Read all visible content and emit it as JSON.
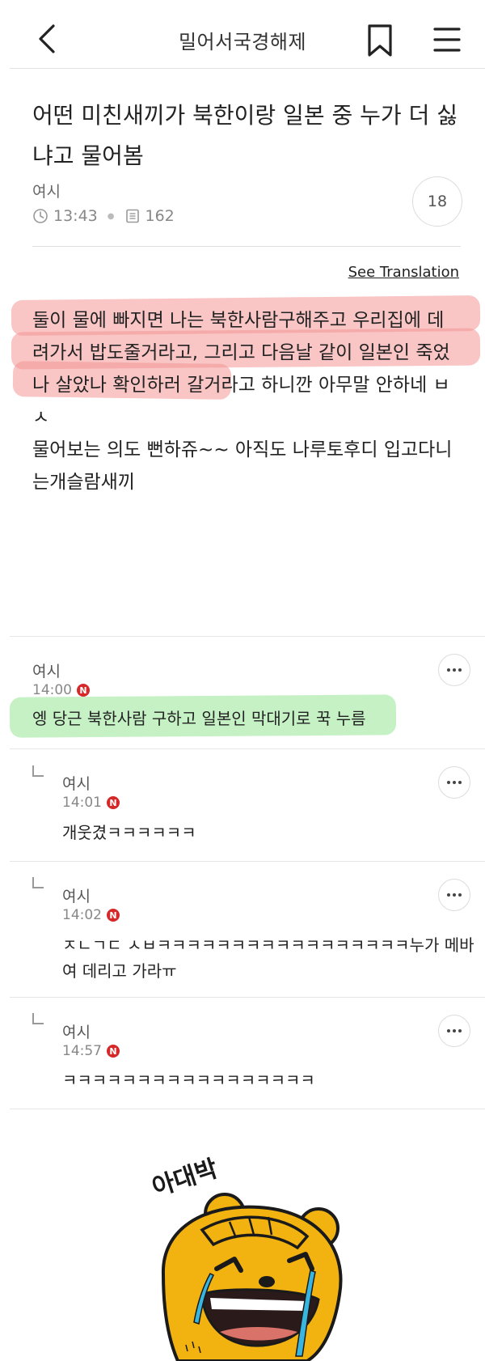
{
  "header": {
    "board_title": "밀어서국경해제",
    "back_icon": "back-arrow-icon",
    "bookmark_icon": "bookmark-icon",
    "menu_icon": "hamburger-menu-icon"
  },
  "post": {
    "title": "어떤 미친새끼가 북한이랑 일본 중 누가 더 싫냐고 물어봄",
    "author": "여시",
    "time": "13:43",
    "views": "162",
    "comment_count": "18",
    "see_translation": "See Translation",
    "body": {
      "line1": "둘이 물에 빠지면 나는 북한사람구해주고 우리집에 데",
      "line2": "려가서 밥도줄거라고, 그리고 다음날 같이 일본인 죽었",
      "line3": "나 살았나 확인하러 갈거라고 하니깐 아무말 안하네 ㅂ",
      "line4": "ㅅ",
      "line5": "물어보는 의도 뻔하쥬~~ 아직도 나루토후디 입고다니",
      "line6": "는개슬람새끼"
    },
    "highlight_color": "#f49696"
  },
  "comments": [
    {
      "author": "여시",
      "time": "14:00",
      "badge": "N",
      "text": "엥 당근 북한사람 구하고 일본인 막대기로 꾹 누름",
      "is_reply": false
    },
    {
      "author": "여시",
      "time": "14:01",
      "badge": "N",
      "text": "개웃겼ㅋㅋㅋㅋㅋㅋ",
      "is_reply": true
    },
    {
      "author": "여시",
      "time": "14:02",
      "badge": "N",
      "text_line1": "ㅈㄴㄱㄷ ㅅㅂㅋㅋㅋㅋㅋㅋㅋㅋㅋㅋㅋㅋㅋㅋㅋㅋㅋ누가 메바",
      "text_line2": "여 데리고 가라ㅠ",
      "is_reply": true
    },
    {
      "author": "여시",
      "time": "14:57",
      "badge": "N",
      "text": "ㅋㅋㅋㅋㅋㅋㅋㅋㅋㅋㅋㅋㅋㅋㅋㅋㅋ",
      "is_reply": true
    }
  ],
  "sticker": {
    "caption": "아대박",
    "colors": {
      "face": "#f2b20f",
      "outline": "#1a1a1a",
      "tears": "#38b6e0",
      "mouth": "#2b1a1a"
    }
  },
  "colors": {
    "badge": "#d62828",
    "green_highlight": "#96e696"
  }
}
